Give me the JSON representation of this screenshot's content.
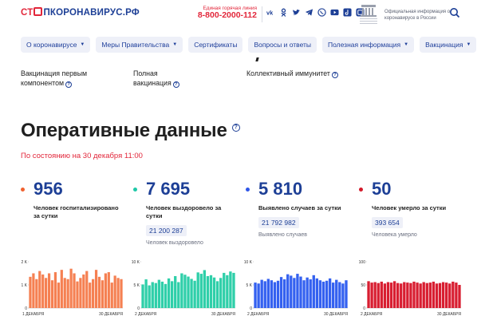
{
  "header": {
    "logo_part1": "СТ",
    "logo_part2": "ПКОРОНАВИРУС.РФ",
    "hotline_label": "Единая горячая линия",
    "hotline_number": "8-800-2000-112",
    "social_icons": [
      "vk-icon",
      "odnoklassniki-icon",
      "twitter-icon",
      "telegram-icon",
      "viber-icon",
      "youtube-icon",
      "tiktok-icon",
      "app-icon"
    ],
    "official_text": "Официальная информация о коронавирусе в России"
  },
  "nav": [
    {
      "label": "О коронавирусе",
      "dropdown": true
    },
    {
      "label": "Меры Правительства",
      "dropdown": true
    },
    {
      "label": "Сертификаты",
      "dropdown": false
    },
    {
      "label": "Вопросы и ответы",
      "dropdown": false
    },
    {
      "label": "Полезная информация",
      "dropdown": true
    },
    {
      "label": "Вакцинация",
      "dropdown": true
    }
  ],
  "vaccination": {
    "first_component": "Вакцинация первым компонентом",
    "full": "Полная вакцинация",
    "herd": "Коллективный иммунитет"
  },
  "main": {
    "title": "Оперативные данные",
    "as_of": "По состоянию на 30 декабря 11:00"
  },
  "stats": [
    {
      "value": "956",
      "desc": "Человек госпитализировано за сутки",
      "total": "",
      "total_label": "",
      "color": "#f0612f"
    },
    {
      "value": "7 695",
      "desc": "Человек выздоровело за сутки",
      "total": "21 200 287",
      "total_label": "Человек выздоровело",
      "color": "#1fc8a8"
    },
    {
      "value": "5 810",
      "desc": "Выявлено случаев за сутки",
      "total": "21 792 982",
      "total_label": "Выявлено случаев",
      "color": "#2f56e8"
    },
    {
      "value": "50",
      "desc": "Человек умерло за сутки",
      "total": "393 654",
      "total_label": "Человека умерло",
      "color": "#d3192a"
    }
  ],
  "chart_data": [
    {
      "type": "bar",
      "color": "#f58052",
      "yticks": [
        "2 K",
        "1 K",
        "0"
      ],
      "ylim": [
        0,
        2000
      ],
      "x_start": "1 ДЕКАБРЯ",
      "x_end": "30 ДЕКАБРЯ",
      "values": [
        1350,
        1500,
        1250,
        1600,
        1450,
        1300,
        1500,
        1200,
        1550,
        1100,
        1650,
        1300,
        1250,
        1700,
        1500,
        1150,
        1300,
        1450,
        1600,
        1100,
        1250,
        1650,
        1350,
        1200,
        1500,
        1550,
        1100,
        1400,
        1300,
        1250
      ]
    },
    {
      "type": "bar",
      "color": "#2fcfa9",
      "yticks": [
        "10 K",
        "5 K",
        "0"
      ],
      "ylim": [
        0,
        10000
      ],
      "x_start": "2 ДЕКАБРЯ",
      "x_end": "30 ДЕКАБРЯ",
      "values": [
        5100,
        6200,
        4900,
        5600,
        5400,
        6100,
        5700,
        5200,
        6400,
        5800,
        6900,
        5600,
        7500,
        7200,
        6800,
        6300,
        5900,
        7700,
        7400,
        8200,
        6900,
        7100,
        6600,
        5800,
        6500,
        7600,
        7100,
        7900,
        7600
      ]
    },
    {
      "type": "bar",
      "color": "#3461f0",
      "yticks": [
        "10 K",
        "5 K",
        "0"
      ],
      "ylim": [
        0,
        10000
      ],
      "x_start": "2 ДЕКАБРЯ",
      "x_end": "30 ДЕКАБРЯ",
      "values": [
        5500,
        5300,
        6100,
        5800,
        6300,
        6000,
        5600,
        5900,
        6700,
        6200,
        7300,
        7000,
        6500,
        7400,
        6800,
        6000,
        6600,
        6200,
        7100,
        6400,
        6000,
        5700,
        5900,
        6400,
        5500,
        6100,
        5600,
        5300,
        6000
      ]
    },
    {
      "type": "bar",
      "color": "#d81e31",
      "yticks": [
        "100",
        "50",
        "0"
      ],
      "ylim": [
        0,
        100
      ],
      "x_start": "2 ДЕКАБРЯ",
      "x_end": "30 ДЕКАБРЯ",
      "values": [
        58,
        55,
        56,
        54,
        57,
        53,
        56,
        55,
        58,
        54,
        53,
        56,
        55,
        54,
        57,
        55,
        53,
        56,
        54,
        55,
        57,
        53,
        54,
        56,
        55,
        53,
        57,
        55,
        50
      ]
    }
  ]
}
